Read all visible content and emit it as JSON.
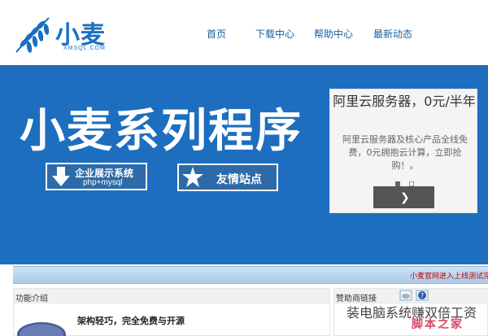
{
  "header": {
    "logo_text": "小麦",
    "logo_sub": "XMSQL.COM",
    "nav": [
      {
        "label": "首页"
      },
      {
        "label": "下载中心"
      },
      {
        "label": "帮助中心"
      },
      {
        "label": "最新动态"
      }
    ]
  },
  "banner": {
    "title": "小麦系列程序",
    "enterprise_button": {
      "line1": "企业展示系统",
      "line2": "php+mysql"
    },
    "friends_button": {
      "label": "友情站点"
    }
  },
  "ad": {
    "title": "阿里云服务器，0元/半年",
    "description": "阿里云服务器及核心产品全线免费，0元拥抱云计算，立即抢购！。",
    "pages": 2,
    "active_page": 1
  },
  "ticker": {
    "text": "小麦官网进入上线测试完"
  },
  "feature": {
    "header": "功能介绍",
    "headline": "架构轻巧，完全免费与开源",
    "logo": "php"
  },
  "sponsor": {
    "header": "赞助商链接",
    "ad_text": "装电脑系统赚双倍工资"
  },
  "watermark": {
    "text": "脚本之家"
  },
  "colors": {
    "brand_blue": "#1a6fc0",
    "banner_bg": "#1d6ebf",
    "ticker_red": "#c00000"
  }
}
